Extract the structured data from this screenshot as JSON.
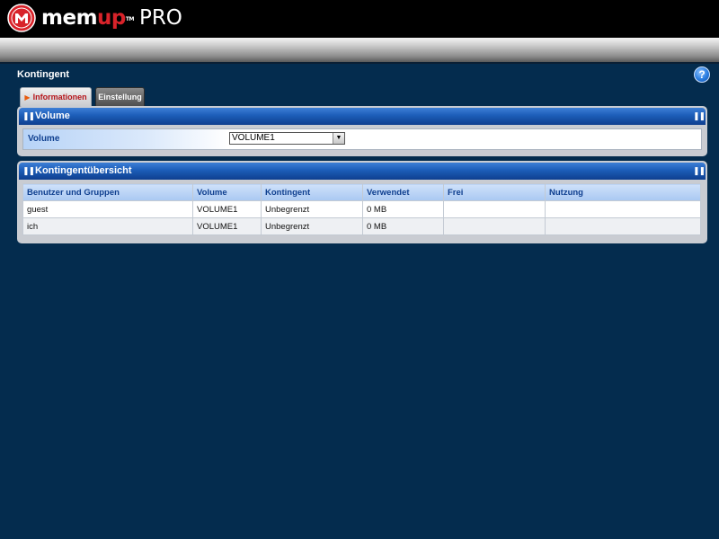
{
  "header": {
    "logo_prefix": "mem",
    "logo_accent": "up",
    "logo_tm": "TM",
    "logo_suffix": "PRO"
  },
  "page": {
    "title": "Kontingent",
    "help_glyph": "?"
  },
  "tabs": [
    {
      "label": "Informationen",
      "active": true
    },
    {
      "label": "Einstellung",
      "active": false
    }
  ],
  "volume_panel": {
    "title": "Volume",
    "field_label": "Volume",
    "selected_value": "VOLUME1"
  },
  "quota_panel": {
    "title": "Kontingentübersicht",
    "columns": [
      "Benutzer und Gruppen",
      "Volume",
      "Kontingent",
      "Verwendet",
      "Frei",
      "Nutzung"
    ],
    "rows": [
      [
        "guest",
        "VOLUME1",
        "Unbegrenzt",
        "0 MB",
        "",
        ""
      ],
      [
        "ich",
        "VOLUME1",
        "Unbegrenzt",
        "0 MB",
        "",
        ""
      ]
    ]
  },
  "colors": {
    "background": "#042c4e",
    "panel_header": "#1c5db8",
    "brand_red": "#d8232a",
    "active_tab_text": "#b7161b"
  },
  "icons": [
    "memup-logo-icon",
    "help-icon",
    "tab-arrow-icon",
    "grip-icon",
    "dropdown-arrow-icon"
  ]
}
